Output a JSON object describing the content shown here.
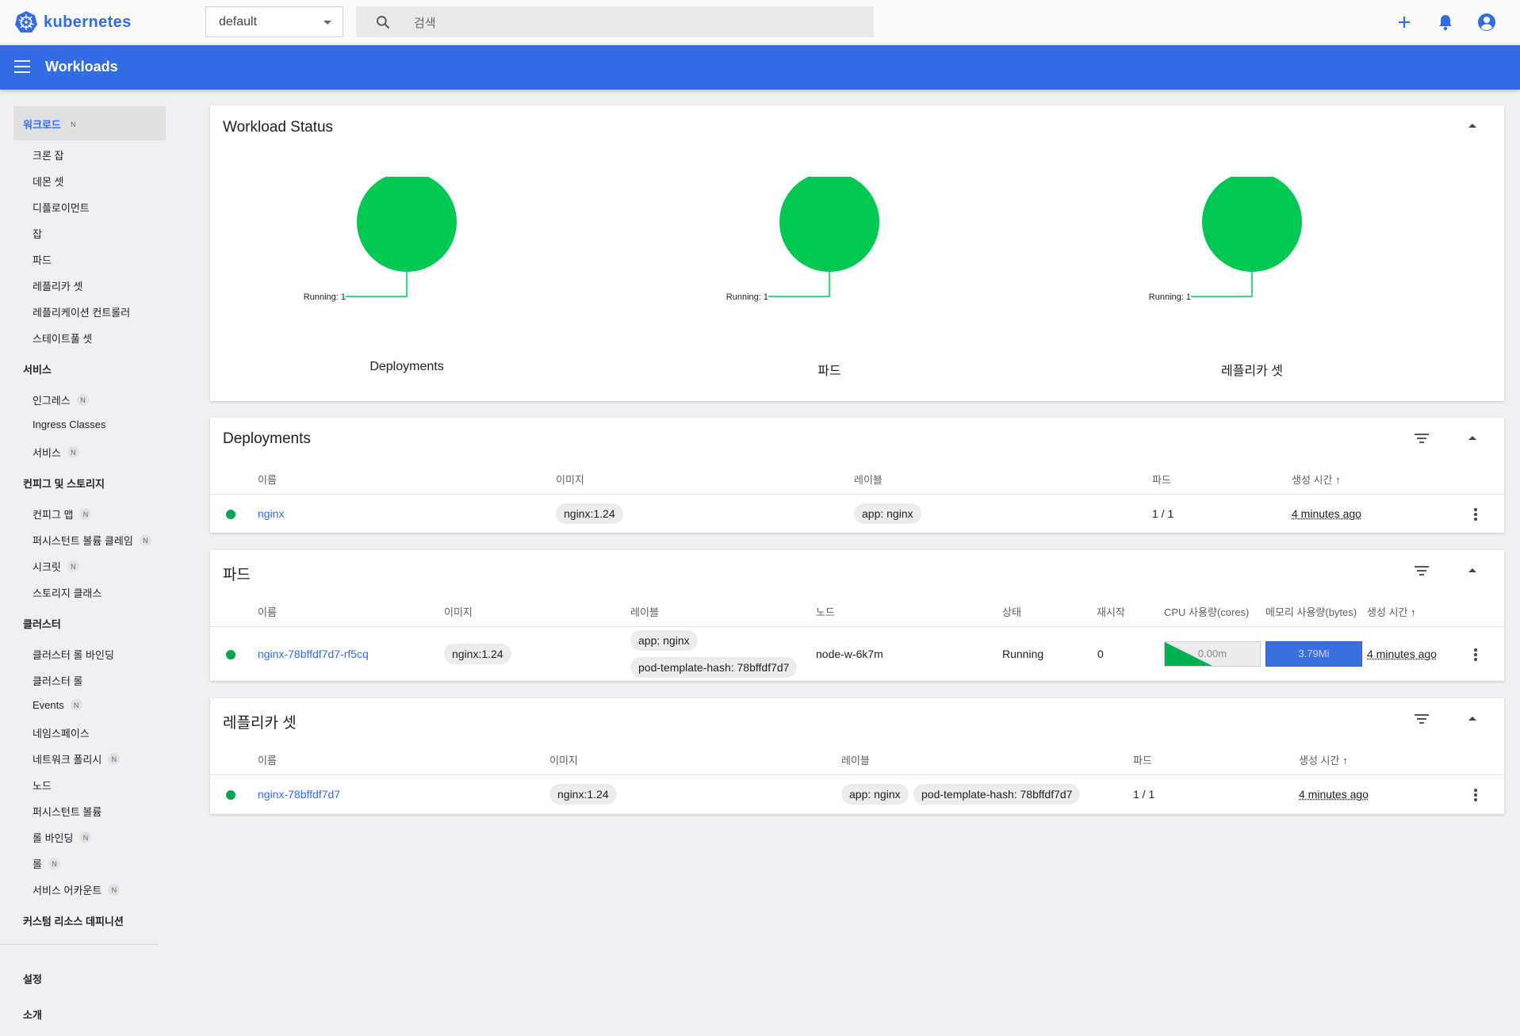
{
  "app": {
    "brand": "kubernetes",
    "title": "Workloads"
  },
  "namespace": {
    "selected": "default"
  },
  "search": {
    "placeholder": "검색"
  },
  "colors": {
    "brand": "#326ce5",
    "running": "#00c853",
    "dot": "#00a650"
  },
  "top_icons": [
    "plus-icon",
    "bell-icon",
    "account-icon"
  ],
  "sidebar": {
    "sections": [
      {
        "label": "워크로드",
        "badge": "N",
        "active": true,
        "items": [
          {
            "label": "크론 잡"
          },
          {
            "label": "데몬 셋"
          },
          {
            "label": "디플로이먼트"
          },
          {
            "label": "잡"
          },
          {
            "label": "파드"
          },
          {
            "label": "레플리카 셋"
          },
          {
            "label": "레플리케이션 컨트롤러"
          },
          {
            "label": "스테이트풀 셋"
          }
        ]
      },
      {
        "label": "서비스",
        "items": [
          {
            "label": "인그레스",
            "badge": "N"
          },
          {
            "label": "Ingress Classes"
          },
          {
            "label": "서비스",
            "badge": "N"
          }
        ]
      },
      {
        "label": "컨피그 및 스토리지",
        "items": [
          {
            "label": "컨피그 맵",
            "badge": "N"
          },
          {
            "label": "퍼시스턴트 볼륨 클레임",
            "badge": "N"
          },
          {
            "label": "시크릿",
            "badge": "N"
          },
          {
            "label": "스토리지 클래스"
          }
        ]
      },
      {
        "label": "클러스터",
        "items": [
          {
            "label": "클러스터 롤 바인딩"
          },
          {
            "label": "클러스터 롤"
          },
          {
            "label": "Events",
            "badge": "N"
          },
          {
            "label": "네임스페이스"
          },
          {
            "label": "네트워크 폴리시",
            "badge": "N"
          },
          {
            "label": "노드"
          },
          {
            "label": "퍼시스턴트 볼륨"
          },
          {
            "label": "롤 바인딩",
            "badge": "N"
          },
          {
            "label": "롤",
            "badge": "N"
          },
          {
            "label": "서비스 어카운트",
            "badge": "N"
          }
        ]
      },
      {
        "label": "커스텀 리소스 데피니션",
        "items": []
      }
    ],
    "bottom": [
      {
        "label": "설정"
      },
      {
        "label": "소개"
      }
    ]
  },
  "workload_status": {
    "title": "Workload Status",
    "charts": [
      {
        "label": "Deployments",
        "running_label": "Running: 1",
        "running": 1
      },
      {
        "label": "파드",
        "running_label": "Running: 1",
        "running": 1
      },
      {
        "label": "레플리카 셋",
        "running_label": "Running: 1",
        "running": 1
      }
    ]
  },
  "deployments": {
    "title": "Deployments",
    "columns": [
      "이름",
      "이미지",
      "레이블",
      "파드",
      "생성 시간"
    ],
    "sort_indicator": "↑",
    "rows": [
      {
        "name": "nginx",
        "image": "nginx:1.24",
        "labels": [
          "app: nginx"
        ],
        "pods": "1 / 1",
        "created": "4 minutes ago"
      }
    ]
  },
  "pods": {
    "title": "파드",
    "columns": [
      "이름",
      "이미지",
      "레이블",
      "노드",
      "상태",
      "재시작",
      "CPU 사용량(cores)",
      "메모리 사용량(bytes)",
      "생성 시간"
    ],
    "sort_indicator": "↑",
    "rows": [
      {
        "name": "nginx-78bffdf7d7-rf5cq",
        "image": "nginx:1.24",
        "labels": [
          "app: nginx",
          "pod-template-hash: 78bffdf7d7"
        ],
        "node": "node-w-6k7m",
        "status": "Running",
        "restarts": "0",
        "cpu": "0.00m",
        "memory": "3.79Mi",
        "created": "4 minutes ago"
      }
    ]
  },
  "replicasets": {
    "title": "레플리카 셋",
    "columns": [
      "이름",
      "이미지",
      "레이블",
      "파드",
      "생성 시간"
    ],
    "sort_indicator": "↑",
    "rows": [
      {
        "name": "nginx-78bffdf7d7",
        "image": "nginx:1.24",
        "labels": [
          "app: nginx",
          "pod-template-hash: 78bffdf7d7"
        ],
        "pods": "1 / 1",
        "created": "4 minutes ago"
      }
    ]
  }
}
